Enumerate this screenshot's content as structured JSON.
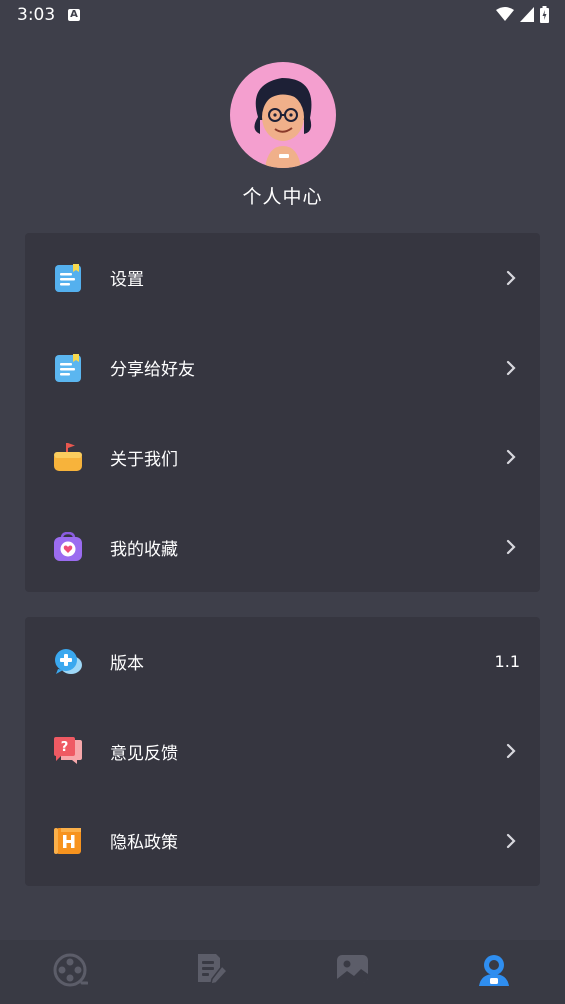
{
  "status_bar": {
    "time": "3:03",
    "notif_icon": "a-icon"
  },
  "profile": {
    "title": "个人中心"
  },
  "menu_group_1": [
    {
      "label": "设置",
      "icon": "document-icon"
    },
    {
      "label": "分享给好友",
      "icon": "document-icon"
    },
    {
      "label": "关于我们",
      "icon": "thumbs-up-icon"
    },
    {
      "label": "我的收藏",
      "icon": "heart-bag-icon"
    }
  ],
  "menu_group_2": [
    {
      "label": "版本",
      "icon": "plus-chat-icon",
      "value": "1.1"
    },
    {
      "label": "意见反馈",
      "icon": "question-chat-icon"
    },
    {
      "label": "隐私政策",
      "icon": "policy-icon"
    }
  ],
  "bottom_nav": [
    {
      "icon": "film-reel-icon"
    },
    {
      "icon": "edit-document-icon"
    },
    {
      "icon": "image-icon"
    },
    {
      "icon": "profile-icon"
    }
  ],
  "colors": {
    "background": "#3e3f4a",
    "card": "#363640",
    "text": "#ffffff",
    "chevron": "#d8d8de"
  }
}
